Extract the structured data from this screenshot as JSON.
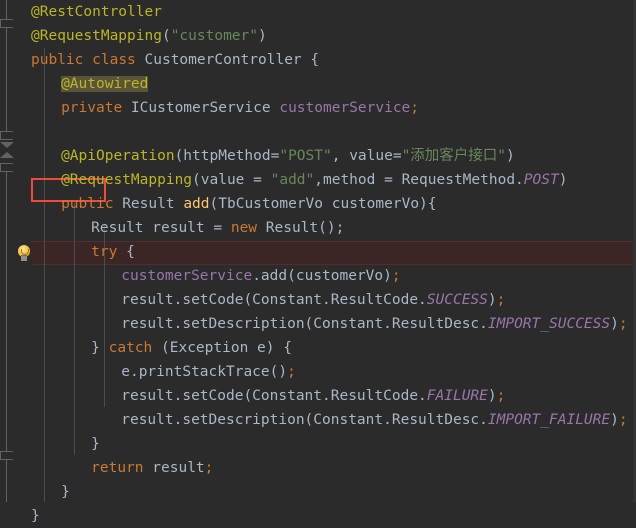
{
  "editor": {
    "theme_name": "darcula",
    "background_color": "#2b2b2b",
    "gutter_color": "#2b2b2b",
    "highlight_row_color": "#3c2525",
    "annotation_box_color": "#f04a3a",
    "search_highlight_color": "#5a5438",
    "font_size_px": 14.5,
    "line_height_px": 24,
    "gutter_icon": "lightbulb-icon"
  },
  "palette": {
    "annotation": "#bbb529",
    "keyword": "#cc7832",
    "string": "#6a8759",
    "default_text": "#a9b7c6",
    "field": "#9876aa",
    "static_constant": "#9876aa",
    "method_declaration": "#ffc66d"
  },
  "code": {
    "language": "java",
    "lines": [
      {
        "n": 1,
        "indent": 0,
        "tokens": [
          {
            "t": "@RestController",
            "c": "t-ann"
          }
        ]
      },
      {
        "n": 2,
        "indent": 0,
        "tokens": [
          {
            "t": "@RequestMapping",
            "c": "t-ann"
          },
          {
            "t": "(",
            "c": "t-txt"
          },
          {
            "t": "\"customer\"",
            "c": "t-str"
          },
          {
            "t": ")",
            "c": "t-txt"
          }
        ]
      },
      {
        "n": 3,
        "indent": 0,
        "tokens": [
          {
            "t": "public",
            "c": "t-kw"
          },
          {
            "t": " ",
            "c": "t-txt"
          },
          {
            "t": "class",
            "c": "t-kw"
          },
          {
            "t": " ",
            "c": "t-txt"
          },
          {
            "t": "CustomerController",
            "c": "t-cls"
          },
          {
            "t": " {",
            "c": "t-txt"
          }
        ]
      },
      {
        "n": 4,
        "indent": 4,
        "tokens": [
          {
            "t": "@Autowired",
            "c": "t-ann hl-ann"
          }
        ]
      },
      {
        "n": 5,
        "indent": 4,
        "tokens": [
          {
            "t": "private",
            "c": "t-kw"
          },
          {
            "t": " ",
            "c": "t-txt"
          },
          {
            "t": "ICustomerService",
            "c": "t-cls"
          },
          {
            "t": " ",
            "c": "t-txt"
          },
          {
            "t": "customerService",
            "c": "t-field"
          },
          {
            "t": ";",
            "c": "t-semi"
          }
        ]
      },
      {
        "n": 6,
        "indent": 0,
        "tokens": []
      },
      {
        "n": 7,
        "indent": 4,
        "tokens": [
          {
            "t": "@ApiOperation",
            "c": "t-ann"
          },
          {
            "t": "(httpMethod=",
            "c": "t-txt"
          },
          {
            "t": "\"POST\"",
            "c": "t-str"
          },
          {
            "t": ", value=",
            "c": "t-txt"
          },
          {
            "t": "\"添加客户接口\"",
            "c": "t-str"
          },
          {
            "t": ")",
            "c": "t-txt"
          }
        ]
      },
      {
        "n": 8,
        "indent": 4,
        "tokens": [
          {
            "t": "@RequestMapping",
            "c": "t-ann"
          },
          {
            "t": "(value = ",
            "c": "t-txt"
          },
          {
            "t": "\"add\"",
            "c": "t-str"
          },
          {
            "t": ",method = RequestMethod.",
            "c": "t-txt"
          },
          {
            "t": "POST",
            "c": "t-const"
          },
          {
            "t": ")",
            "c": "t-txt"
          }
        ]
      },
      {
        "n": 9,
        "indent": 4,
        "tokens": [
          {
            "t": "public",
            "c": "t-kw"
          },
          {
            "t": " ",
            "c": "t-txt"
          },
          {
            "t": "Result",
            "c": "t-cls"
          },
          {
            "t": " ",
            "c": "t-txt"
          },
          {
            "t": "add",
            "c": "t-meth"
          },
          {
            "t": "(TbCustomerVo customerVo){",
            "c": "t-txt"
          }
        ]
      },
      {
        "n": 10,
        "indent": 8,
        "tokens": [
          {
            "t": "Result result = ",
            "c": "t-txt"
          },
          {
            "t": "new",
            "c": "t-kw"
          },
          {
            "t": " Result();",
            "c": "t-txt"
          }
        ]
      },
      {
        "n": 11,
        "indent": 8,
        "tokens": [
          {
            "t": "try",
            "c": "t-kw"
          },
          {
            "t": " {",
            "c": "t-txt"
          }
        ]
      },
      {
        "n": 12,
        "indent": 12,
        "highlighted": true,
        "tokens": [
          {
            "t": "customerService",
            "c": "t-field"
          },
          {
            "t": ".add(customerVo)",
            "c": "t-txt"
          },
          {
            "t": ";",
            "c": "t-semi"
          }
        ]
      },
      {
        "n": 13,
        "indent": 12,
        "tokens": [
          {
            "t": "result.setCode(Constant.ResultCode.",
            "c": "t-txt"
          },
          {
            "t": "SUCCESS",
            "c": "t-const"
          },
          {
            "t": ")",
            "c": "t-txt"
          },
          {
            "t": ";",
            "c": "t-semi"
          }
        ]
      },
      {
        "n": 14,
        "indent": 12,
        "tokens": [
          {
            "t": "result.setDescription(Constant.ResultDesc.",
            "c": "t-txt"
          },
          {
            "t": "IMPORT_SUCCESS",
            "c": "t-const"
          },
          {
            "t": ")",
            "c": "t-txt"
          },
          {
            "t": ";",
            "c": "t-semi"
          }
        ]
      },
      {
        "n": 15,
        "indent": 8,
        "tokens": [
          {
            "t": "} ",
            "c": "t-txt"
          },
          {
            "t": "catch",
            "c": "t-kw"
          },
          {
            "t": " (Exception e) {",
            "c": "t-txt"
          }
        ]
      },
      {
        "n": 16,
        "indent": 12,
        "tokens": [
          {
            "t": "e.printStackTrace()",
            "c": "t-txt"
          },
          {
            "t": ";",
            "c": "t-semi"
          }
        ]
      },
      {
        "n": 17,
        "indent": 12,
        "tokens": [
          {
            "t": "result.setCode(Constant.ResultCode.",
            "c": "t-txt"
          },
          {
            "t": "FAILURE",
            "c": "t-const"
          },
          {
            "t": ")",
            "c": "t-txt"
          },
          {
            "t": ";",
            "c": "t-semi"
          }
        ]
      },
      {
        "n": 18,
        "indent": 12,
        "tokens": [
          {
            "t": "result.setDescription(Constant.ResultDesc.",
            "c": "t-txt"
          },
          {
            "t": "IMPORT_FAILURE",
            "c": "t-const"
          },
          {
            "t": ")",
            "c": "t-txt"
          },
          {
            "t": ";",
            "c": "t-semi"
          }
        ]
      },
      {
        "n": 19,
        "indent": 8,
        "tokens": [
          {
            "t": "}",
            "c": "t-txt"
          }
        ]
      },
      {
        "n": 20,
        "indent": 8,
        "tokens": [
          {
            "t": "return",
            "c": "t-kw"
          },
          {
            "t": " result",
            "c": "t-txt"
          },
          {
            "t": ";",
            "c": "t-semi"
          }
        ]
      },
      {
        "n": 21,
        "indent": 4,
        "tokens": [
          {
            "t": "}",
            "c": "t-txt"
          }
        ]
      },
      {
        "n": 22,
        "indent": 0,
        "tokens": [
          {
            "t": "}",
            "c": "t-txt"
          }
        ]
      }
    ]
  }
}
